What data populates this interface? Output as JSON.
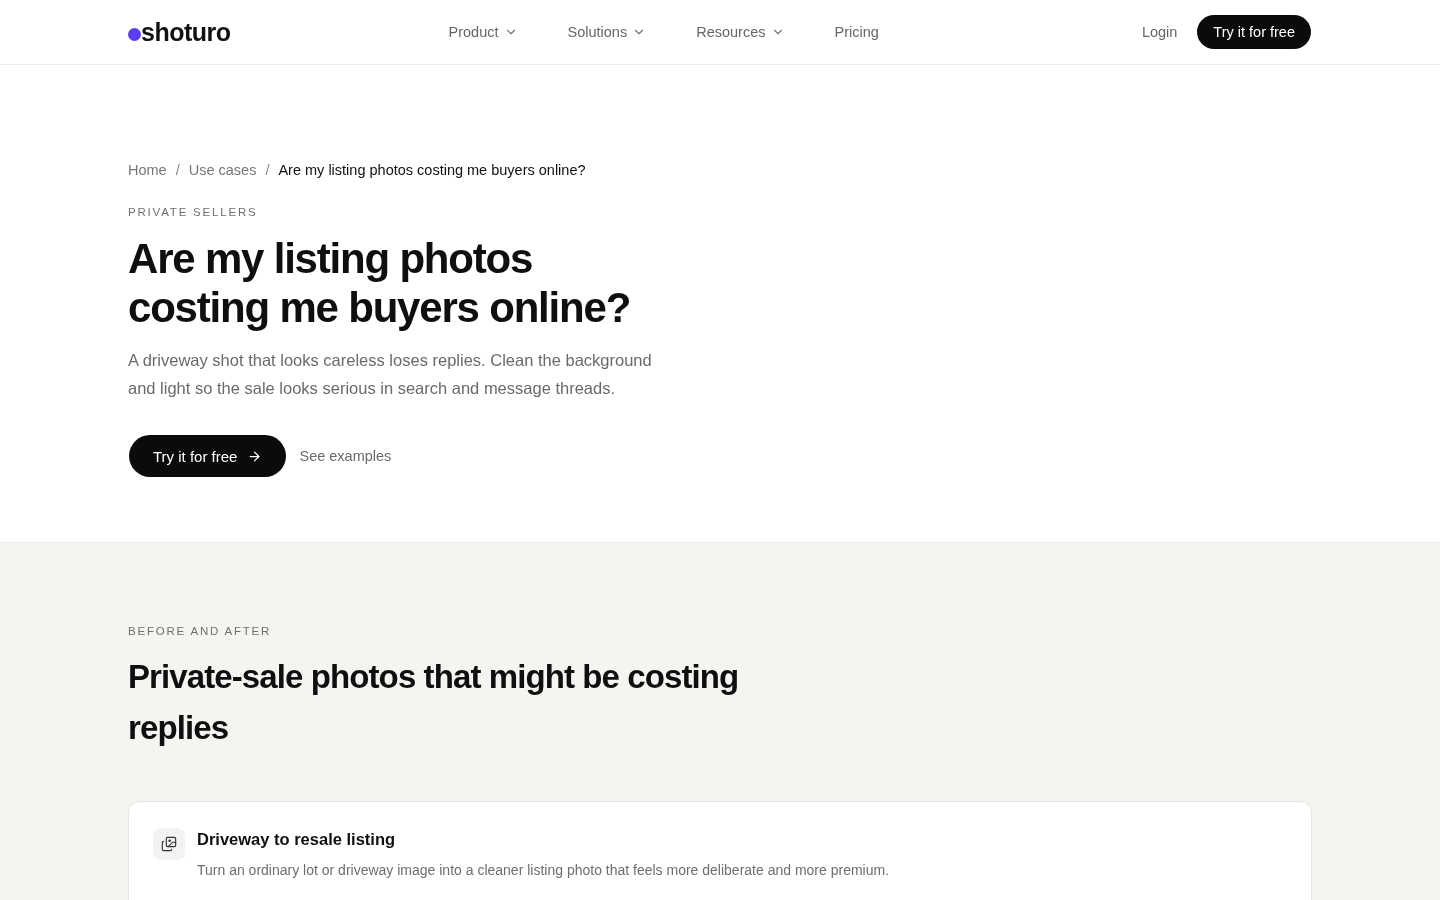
{
  "header": {
    "logo": "shoturo",
    "nav": [
      {
        "label": "Product",
        "kind": "dropdown"
      },
      {
        "label": "Solutions",
        "kind": "dropdown"
      },
      {
        "label": "Resources",
        "kind": "dropdown"
      },
      {
        "label": "Pricing",
        "kind": "link"
      }
    ],
    "login": "Login",
    "cta": "Try it for free"
  },
  "hero": {
    "breadcrumb": [
      {
        "label": "Home",
        "current": false
      },
      {
        "label": "Use cases",
        "current": false
      },
      {
        "label": "Are my listing photos costing me buyers online?",
        "current": true
      }
    ],
    "breadcrumb_separators": [
      "/",
      "/"
    ],
    "eyebrow": "PRIVATE SELLERS",
    "title": "Are my listing photos costing me buyers online?",
    "description": "A driveway shot that looks careless loses replies. Clean the background and light so the sale looks serious in search and message threads.",
    "primary_button": "Try it for free",
    "secondary_link": "See examples"
  },
  "before_after": {
    "eyebrow": "BEFORE AND AFTER",
    "title": "Private-sale photos that might be costing replies",
    "cards": [
      {
        "title": "Driveway to resale listing",
        "description": "Turn an ordinary lot or driveway image into a cleaner listing photo that feels more deliberate and more premium."
      }
    ]
  }
}
